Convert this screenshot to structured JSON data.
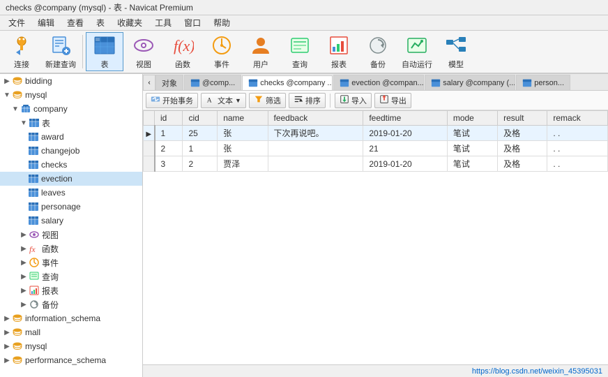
{
  "titleBar": {
    "title": "checks @company (mysql) - 表 - Navicat Premium"
  },
  "menuBar": {
    "items": [
      "文件",
      "编辑",
      "查看",
      "表",
      "收藏夹",
      "工具",
      "窗口",
      "帮助"
    ]
  },
  "toolbar": {
    "buttons": [
      {
        "id": "connect",
        "label": "连接",
        "icon": "connect"
      },
      {
        "id": "newquery",
        "label": "新建查询",
        "icon": "newquery"
      },
      {
        "id": "table",
        "label": "表",
        "icon": "table",
        "active": true
      },
      {
        "id": "view",
        "label": "视图",
        "icon": "view"
      },
      {
        "id": "function",
        "label": "函数",
        "icon": "function"
      },
      {
        "id": "event",
        "label": "事件",
        "icon": "event"
      },
      {
        "id": "user",
        "label": "用户",
        "icon": "user"
      },
      {
        "id": "query",
        "label": "查询",
        "icon": "query"
      },
      {
        "id": "report",
        "label": "报表",
        "icon": "report"
      },
      {
        "id": "backup",
        "label": "备份",
        "icon": "backup"
      },
      {
        "id": "autorun",
        "label": "自动运行",
        "icon": "autorun"
      },
      {
        "id": "model",
        "label": "模型",
        "icon": "model"
      }
    ]
  },
  "sidebar": {
    "items": [
      {
        "id": "bidding",
        "label": "bidding",
        "level": 0,
        "type": "db",
        "expanded": false
      },
      {
        "id": "mysql",
        "label": "mysql",
        "level": 0,
        "type": "db",
        "expanded": true
      },
      {
        "id": "company",
        "label": "company",
        "level": 1,
        "type": "schema",
        "expanded": true
      },
      {
        "id": "tables-group",
        "label": "表",
        "level": 2,
        "type": "group",
        "expanded": true
      },
      {
        "id": "award",
        "label": "award",
        "level": 3,
        "type": "table"
      },
      {
        "id": "changejob",
        "label": "changejob",
        "level": 3,
        "type": "table"
      },
      {
        "id": "checks",
        "label": "checks",
        "level": 3,
        "type": "table"
      },
      {
        "id": "evection",
        "label": "evection",
        "level": 3,
        "type": "table",
        "selected": true
      },
      {
        "id": "leaves",
        "label": "leaves",
        "level": 3,
        "type": "table"
      },
      {
        "id": "personage",
        "label": "personage",
        "level": 3,
        "type": "table"
      },
      {
        "id": "salary",
        "label": "salary",
        "level": 3,
        "type": "table"
      },
      {
        "id": "views-group",
        "label": "视图",
        "level": 2,
        "type": "group",
        "expanded": false
      },
      {
        "id": "functions-group",
        "label": "函数",
        "level": 2,
        "type": "group",
        "expanded": false
      },
      {
        "id": "events-group",
        "label": "事件",
        "level": 2,
        "type": "group",
        "expanded": false
      },
      {
        "id": "queries-group",
        "label": "查询",
        "level": 2,
        "type": "group",
        "expanded": false
      },
      {
        "id": "reports-group",
        "label": "报表",
        "level": 2,
        "type": "group",
        "expanded": false
      },
      {
        "id": "backups-group",
        "label": "备份",
        "level": 2,
        "type": "group",
        "expanded": false
      },
      {
        "id": "information_schema",
        "label": "information_schema",
        "level": 0,
        "type": "db",
        "expanded": false
      },
      {
        "id": "mall",
        "label": "mall",
        "level": 0,
        "type": "db",
        "expanded": false
      },
      {
        "id": "mysql2",
        "label": "mysql",
        "level": 0,
        "type": "db",
        "expanded": false
      },
      {
        "id": "performance_schema",
        "label": "performance_schema",
        "level": 0,
        "type": "db",
        "expanded": false
      }
    ]
  },
  "tabs": {
    "items": [
      {
        "id": "objects",
        "label": "对象",
        "active": false
      },
      {
        "id": "comp",
        "label": "@comp...",
        "icon": "table",
        "active": false
      },
      {
        "id": "checks",
        "label": "checks @company ...",
        "icon": "table",
        "active": true
      },
      {
        "id": "evection",
        "label": "evection @compan...",
        "icon": "table",
        "active": false
      },
      {
        "id": "salary",
        "label": "salary @company (...",
        "icon": "table",
        "active": false
      },
      {
        "id": "person",
        "label": "person...",
        "icon": "table",
        "active": false
      }
    ]
  },
  "actionBar": {
    "buttons": [
      {
        "id": "begin-transaction",
        "label": "开始事务",
        "icon": "transaction"
      },
      {
        "id": "text",
        "label": "文本",
        "icon": "text"
      },
      {
        "id": "filter",
        "label": "筛选",
        "icon": "filter"
      },
      {
        "id": "sort",
        "label": "排序",
        "icon": "sort"
      },
      {
        "id": "import",
        "label": "导入",
        "icon": "import"
      },
      {
        "id": "export",
        "label": "导出",
        "icon": "export"
      }
    ]
  },
  "table": {
    "columns": [
      "id",
      "cid",
      "name",
      "feedback",
      "feedtime",
      "mode",
      "result",
      "remack"
    ],
    "rows": [
      {
        "id": "1",
        "cid": "25",
        "name": "张",
        "feedback": "下次再说吧。",
        "feedtime": "2019-01-20",
        "mode": "笔试",
        "result": "及格",
        "remack": ". .",
        "current": true
      },
      {
        "id": "2",
        "cid": "1",
        "name": "张",
        "feedback": "",
        "feedtime": "21",
        "mode": "笔试",
        "result": "及格",
        "remack": ". ."
      },
      {
        "id": "3",
        "cid": "2",
        "name": "贾泽",
        "feedback": "",
        "feedtime": "2019-01-20",
        "mode": "笔试",
        "result": "及格",
        "remack": ". ."
      }
    ]
  },
  "statusBar": {
    "url": "https://blog.csdn.net/weixin_45395031"
  }
}
